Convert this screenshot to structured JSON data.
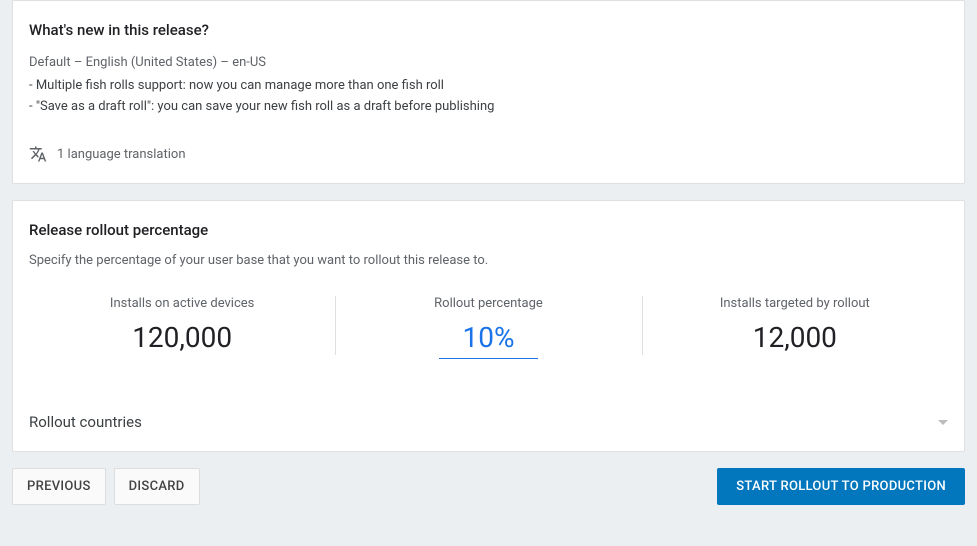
{
  "whats_new": {
    "title": "What's new in this release?",
    "default_lang_line": "Default – English (United States) – en-US",
    "notes_line1": "- Multiple fish rolls support: now you can manage more than one fish roll",
    "notes_line2": "- \"Save as a draft roll\": you can save your new fish roll as a draft before publishing",
    "translation_count": "1 language translation"
  },
  "rollout": {
    "title": "Release rollout percentage",
    "desc": "Specify the percentage of your user base that you want to rollout this release to.",
    "stats": {
      "active_label": "Installs on active devices",
      "active_value": "120,000",
      "percent_label": "Rollout percentage",
      "percent_value": "10%",
      "targeted_label": "Installs targeted by rollout",
      "targeted_value": "12,000"
    },
    "countries_label": "Rollout countries"
  },
  "buttons": {
    "previous": "Previous",
    "discard": "Discard",
    "start": "Start rollout to production"
  }
}
